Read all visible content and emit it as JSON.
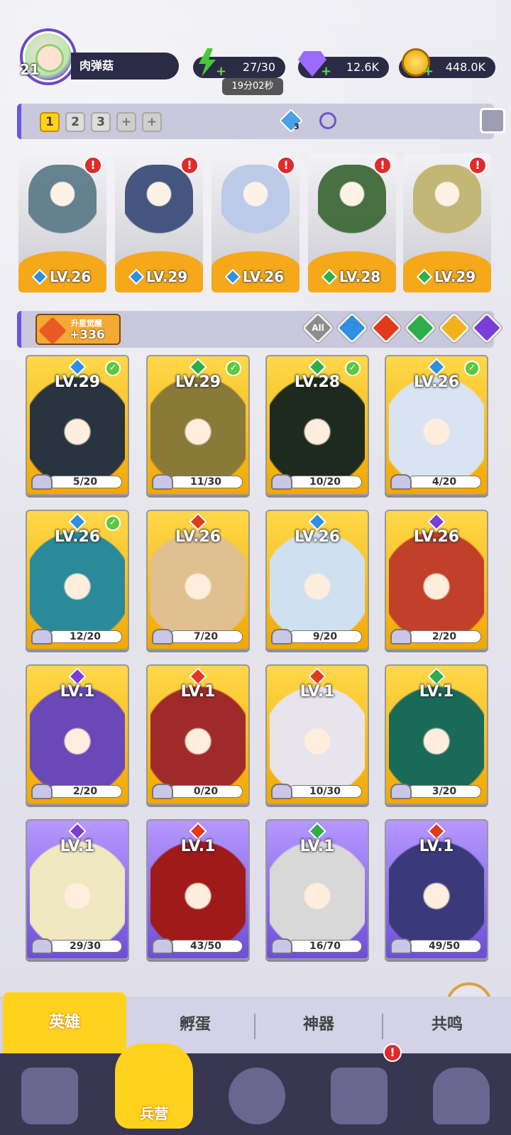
{
  "player": {
    "level": "21",
    "name": "肉弹菇"
  },
  "resources": {
    "energy": "27/30",
    "energy_timer": "19分02秒",
    "gems": "12.6K",
    "gold": "448.0K"
  },
  "teams": {
    "tabs": [
      "1",
      "2",
      "3",
      "+",
      "+"
    ],
    "active": "1",
    "diamond_count": "3"
  },
  "team_heroes": [
    {
      "level": "LV.26",
      "element": "water"
    },
    {
      "level": "LV.29",
      "element": "water"
    },
    {
      "level": "LV.26",
      "element": "water"
    },
    {
      "level": "LV.28",
      "element": "nature"
    },
    {
      "level": "LV.29",
      "element": "nature"
    }
  ],
  "awaken": {
    "label": "升星觉醒",
    "value": "+336"
  },
  "filters": [
    "All",
    "water",
    "fire",
    "nature",
    "light",
    "dark"
  ],
  "heroes": [
    {
      "level": "LV.29",
      "progress": "5/20",
      "element": "water",
      "checked": true,
      "frame": "gold"
    },
    {
      "level": "LV.29",
      "progress": "11/30",
      "element": "nature",
      "checked": true,
      "frame": "gold"
    },
    {
      "level": "LV.28",
      "progress": "10/20",
      "element": "nature",
      "checked": true,
      "frame": "gold"
    },
    {
      "level": "LV.26",
      "progress": "4/20",
      "element": "water",
      "checked": true,
      "frame": "gold"
    },
    {
      "level": "LV.26",
      "progress": "12/20",
      "element": "water",
      "checked": true,
      "frame": "gold"
    },
    {
      "level": "LV.26",
      "progress": "7/20",
      "element": "fire",
      "checked": false,
      "frame": "gold"
    },
    {
      "level": "LV.26",
      "progress": "9/20",
      "element": "water",
      "checked": false,
      "frame": "gold"
    },
    {
      "level": "LV.26",
      "progress": "2/20",
      "element": "dark",
      "checked": false,
      "frame": "gold"
    },
    {
      "level": "LV.1",
      "progress": "2/20",
      "element": "dark",
      "checked": false,
      "frame": "gold"
    },
    {
      "level": "LV.1",
      "progress": "0/20",
      "element": "fire",
      "checked": false,
      "frame": "gold"
    },
    {
      "level": "LV.1",
      "progress": "10/30",
      "element": "fire",
      "checked": false,
      "frame": "gold"
    },
    {
      "level": "LV.1",
      "progress": "3/20",
      "element": "nature",
      "checked": false,
      "frame": "gold"
    },
    {
      "level": "LV.1",
      "progress": "29/30",
      "element": "dark",
      "checked": false,
      "frame": "purple"
    },
    {
      "level": "LV.1",
      "progress": "43/50",
      "element": "fire",
      "checked": false,
      "frame": "purple"
    },
    {
      "level": "LV.1",
      "progress": "16/70",
      "element": "nature",
      "checked": false,
      "frame": "purple"
    },
    {
      "level": "LV.1",
      "progress": "49/50",
      "element": "fire",
      "checked": false,
      "frame": "purple"
    }
  ],
  "subtabs": [
    "英雄",
    "孵蛋",
    "神器",
    "共鸣"
  ],
  "nav": {
    "barracks_label": "兵营"
  },
  "colors": {
    "water": "#2f8fe0",
    "fire": "#e23a1c",
    "nature": "#2fae4a",
    "light": "#f2b21c",
    "dark": "#7a3fd6",
    "accent": "#ffd31d"
  }
}
